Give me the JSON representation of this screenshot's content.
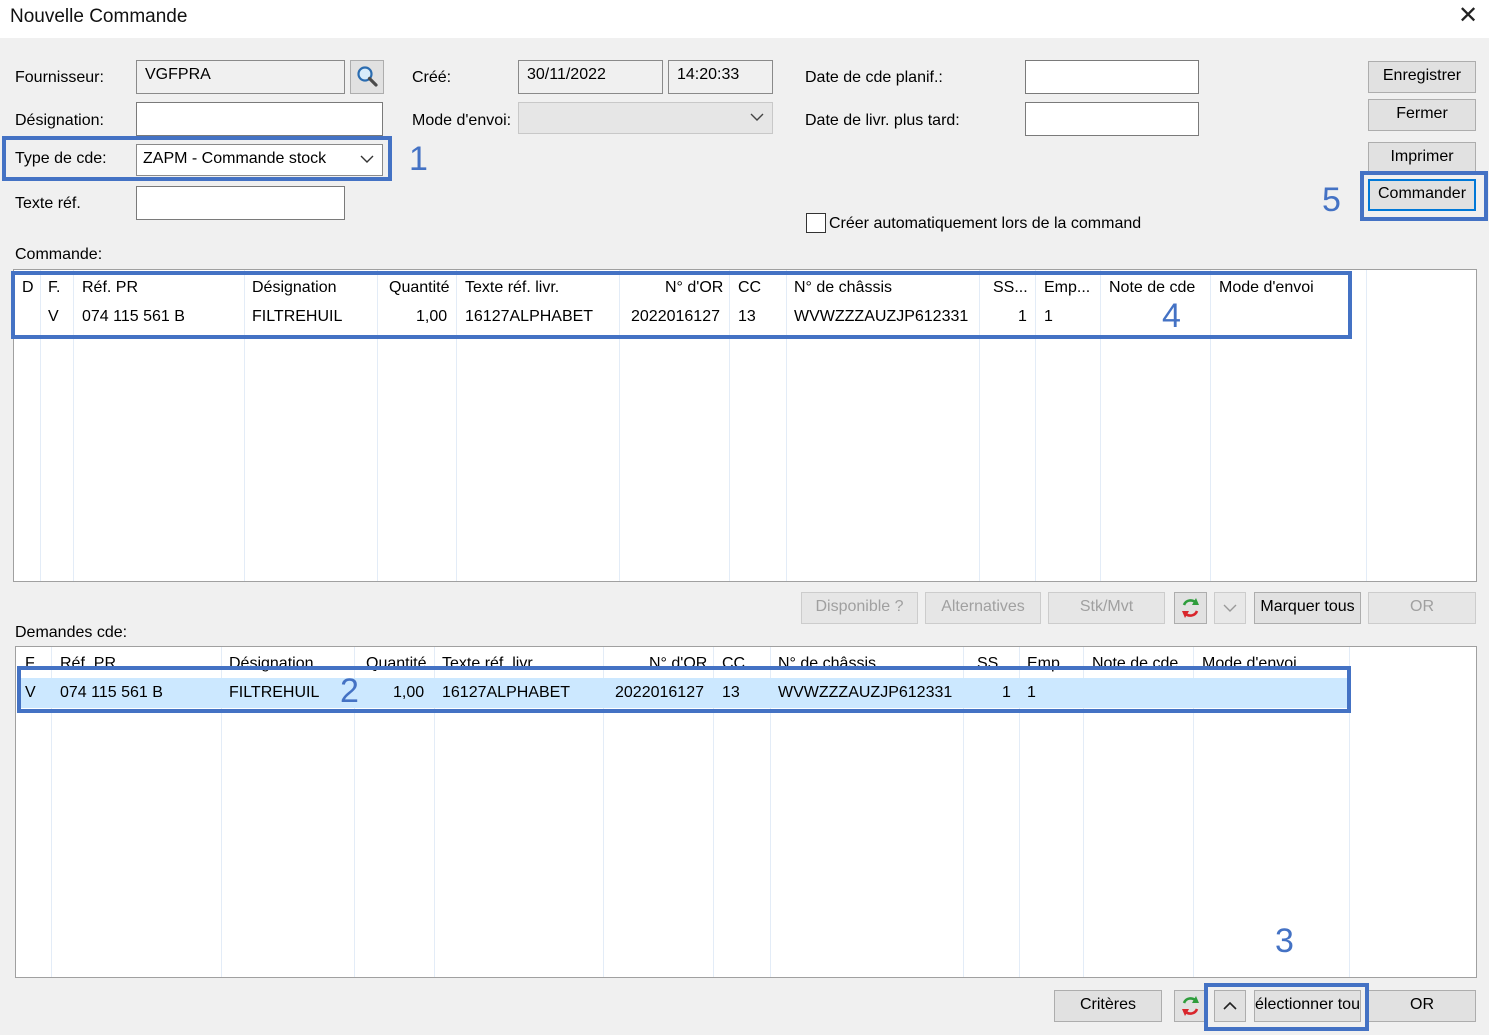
{
  "window": {
    "title": "Nouvelle Commande",
    "close_glyph": "✕"
  },
  "header": {
    "fournisseur": {
      "label": "Fournisseur:",
      "value": "VGFPRA"
    },
    "designation": {
      "label": "Désignation:",
      "value": ""
    },
    "type_cde": {
      "label": "Type de cde:",
      "value": "ZAPM - Commande stock"
    },
    "texte_ref": {
      "label": "Texte réf.",
      "value": ""
    },
    "cree": {
      "label": "Créé:",
      "date": "30/11/2022",
      "time": "14:20:33"
    },
    "mode_envoi": {
      "label": "Mode d'envoi:",
      "value": ""
    },
    "date_cde_planif": {
      "label": "Date de cde planif.:",
      "value": ""
    },
    "date_livr_plus_tard": {
      "label": "Date de livr. plus tard:",
      "value": ""
    },
    "auto_checkbox_label": "Créer automatiquement lors de la command"
  },
  "buttons": {
    "enregistrer": "Enregistrer",
    "fermer": "Fermer",
    "imprimer": "Imprimer",
    "commander": "Commander"
  },
  "commande": {
    "section_label": "Commande:",
    "columns": [
      "D",
      "F.",
      "Réf. PR",
      "Désignation",
      "Quantité",
      "Texte réf. livr.",
      "N° d'OR",
      "CC",
      "N° de châssis",
      "SS...",
      "Emp...",
      "Note de cde",
      "Mode d'envoi"
    ],
    "rows": [
      {
        "D": "",
        "F": "V",
        "ref_pr": "074 115 561 B",
        "designation": "FILTREHUIL",
        "quantite": "1,00",
        "texte_ref_livr": "16127ALPHABET",
        "no_or": "2022016127",
        "cc": "13",
        "chassis": "WVWZZZAUZJP612331",
        "ss": "1",
        "emp": "1",
        "note": "",
        "mode": ""
      }
    ]
  },
  "middle_toolbar": {
    "disponible": "Disponible ?",
    "alternatives": "Alternatives",
    "stk_mvt": "Stk/Mvt",
    "marquer_tous": "Marquer tous",
    "or": "OR",
    "refresh_icon": "refresh-icon",
    "dropdown_icon": "chevron-down-icon"
  },
  "demandes": {
    "section_label": "Demandes cde:",
    "columns": [
      "F.",
      "Réf. PR",
      "Désignation",
      "Quantité",
      "Texte réf. livr.",
      "N° d'OR",
      "CC",
      "N° de châssis",
      "SS...",
      "Emp...",
      "Note de cde",
      "Mode d'envoi"
    ],
    "rows": [
      {
        "F": "V",
        "ref_pr": "074 115 561 B",
        "designation": "FILTREHUIL",
        "quantite": "1,00",
        "texte_ref_livr": "16127ALPHABET",
        "no_or": "2022016127",
        "cc": "13",
        "chassis": "WVWZZZAUZJP612331",
        "ss": "1",
        "emp": "1",
        "note": "",
        "mode": ""
      }
    ]
  },
  "bottom_toolbar": {
    "criteres": "Critères",
    "selectionner_tous": "électionner tou",
    "or": "OR",
    "up_icon": "chevron-up-icon",
    "refresh_icon": "refresh-icon"
  },
  "annotations": [
    "1",
    "2",
    "3",
    "4",
    "5"
  ],
  "colors": {
    "annotation": "#4472c4",
    "selection": "#cce8ff",
    "default_button_border": "#0078d7"
  }
}
